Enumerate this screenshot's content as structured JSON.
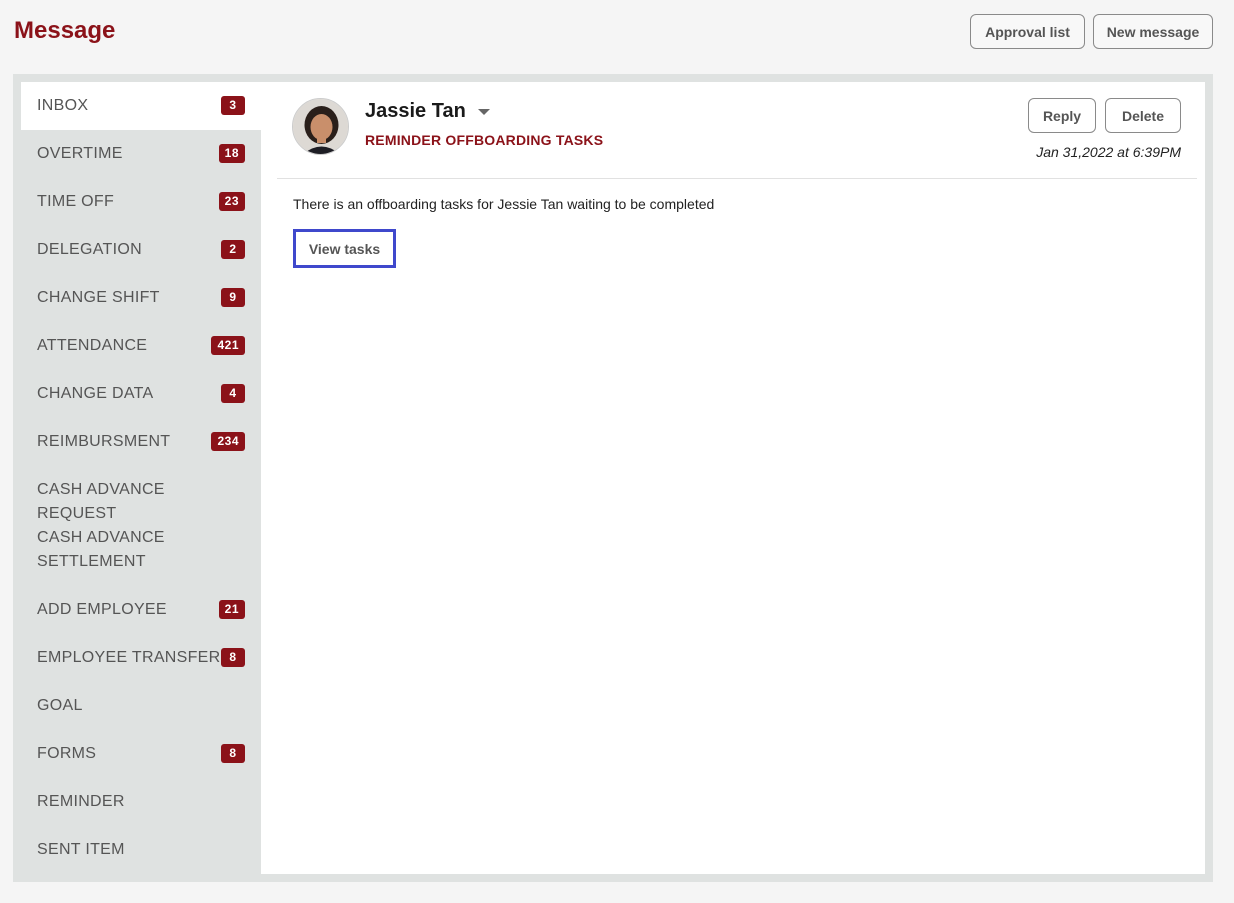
{
  "header": {
    "title": "Message",
    "approval_label": "Approval list",
    "new_message_label": "New message"
  },
  "sidebar": {
    "items": [
      {
        "label": "INBOX",
        "badge": "3",
        "active": true
      },
      {
        "label": "OVERTIME",
        "badge": "18"
      },
      {
        "label": "TIME OFF",
        "badge": "23"
      },
      {
        "label": "DELEGATION",
        "badge": "2"
      },
      {
        "label": "CHANGE SHIFT",
        "badge": "9"
      },
      {
        "label": "ATTENDANCE",
        "badge": "421"
      },
      {
        "label": "CHANGE DATA",
        "badge": "4"
      },
      {
        "label": "REIMBURSMENT",
        "badge": "234"
      },
      {
        "label": "CASH ADVANCE REQUEST",
        "badge": ""
      },
      {
        "label": "CASH ADVANCE SETTLEMENT",
        "badge": ""
      },
      {
        "label": "ADD EMPLOYEE",
        "badge": "21"
      },
      {
        "label": "EMPLOYEE TRANSFER",
        "badge": "8"
      },
      {
        "label": "GOAL",
        "badge": ""
      },
      {
        "label": "FORMS",
        "badge": "8"
      },
      {
        "label": "REMINDER",
        "badge": ""
      },
      {
        "label": "SENT ITEM",
        "badge": ""
      }
    ]
  },
  "message": {
    "sender": "Jassie Tan",
    "subject": "REMINDER OFFBOARDING TASKS",
    "date": "Jan 31,2022 at 6:39PM",
    "reply_label": "Reply",
    "delete_label": "Delete",
    "body": "There is an offboarding tasks for Jessie Tan waiting to be completed",
    "view_tasks_label": "View tasks"
  },
  "colors": {
    "brand": "#8b1219",
    "focus": "#3f48cc"
  }
}
